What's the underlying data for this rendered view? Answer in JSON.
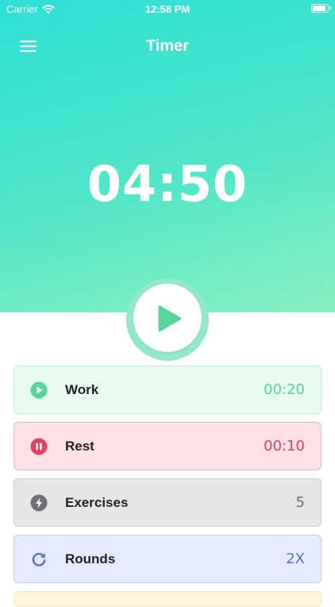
{
  "status_bar": {
    "carrier": "Carrier",
    "time": "12:58 PM",
    "battery_level": 0.95
  },
  "nav": {
    "title": "Timer",
    "menu_icon": "hamburger-menu-icon"
  },
  "timer": {
    "display": "04:50"
  },
  "play_button": {
    "icon": "play-icon"
  },
  "rows": [
    {
      "id": "work",
      "label": "Work",
      "value": "00:20",
      "icon": "play-circle-icon",
      "color": "#58d59a"
    },
    {
      "id": "rest",
      "label": "Rest",
      "value": "00:10",
      "icon": "pause-circle-icon",
      "color": "#e93d5c"
    },
    {
      "id": "exercises",
      "label": "Exercises",
      "value": "5",
      "icon": "lightning-icon",
      "color": "#707078"
    },
    {
      "id": "rounds",
      "label": "Rounds",
      "value": "2X",
      "icon": "refresh-icon",
      "color": "#5b6fd9"
    }
  ],
  "colors": {
    "gradient_start": "#2de0d6",
    "gradient_end": "#86efc0",
    "play_green": "#58d59a"
  }
}
